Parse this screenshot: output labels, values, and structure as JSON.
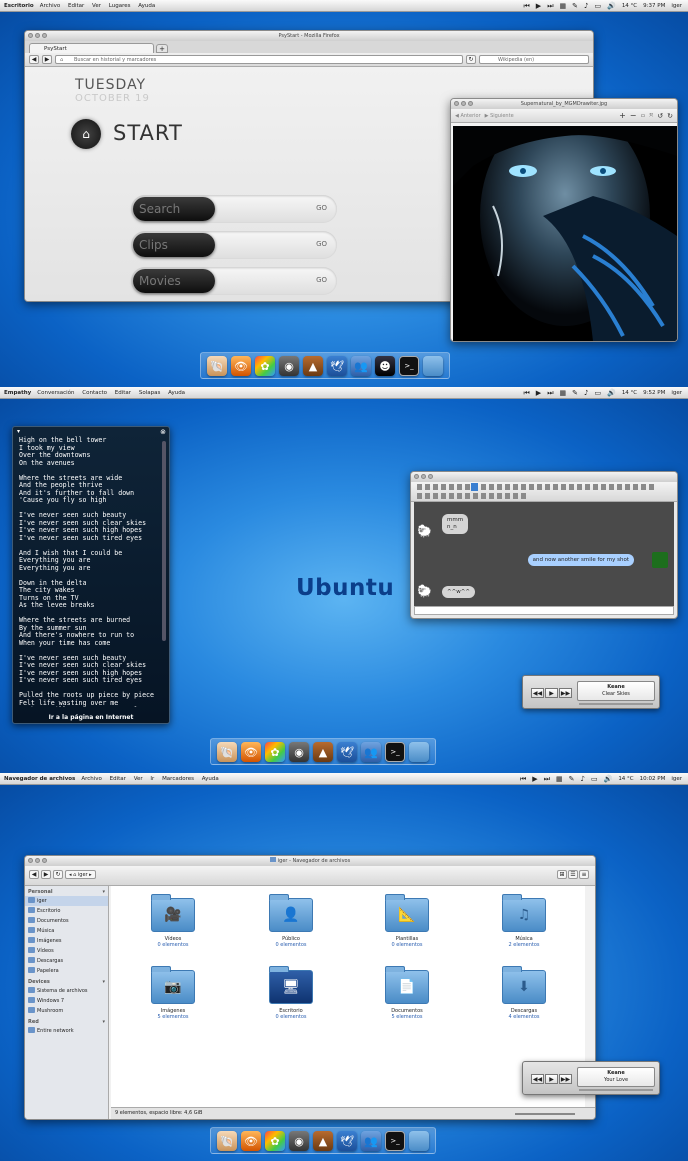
{
  "screen1": {
    "panel": {
      "app": "Escritorio",
      "menus": [
        "Archivo",
        "Editar",
        "Ver",
        "Lugares",
        "Ayuda"
      ],
      "temp": "14 °C",
      "time": "9:37 PM",
      "user": "iger"
    },
    "firefox": {
      "title": "PsyStart - Mozilla Firefox",
      "tab": "PsyStart",
      "url_placeholder": "Buscar en historial y marcadores",
      "search_placeholder": "Wikipedia (en)",
      "day": "TUESDAY",
      "date": "OCTOBER 19",
      "start": "START",
      "rows": [
        {
          "label": "Search",
          "go": "GO"
        },
        {
          "label": "Clips",
          "go": "GO"
        },
        {
          "label": "Movies",
          "go": "GO"
        }
      ]
    },
    "viewer": {
      "title": "Supernatural_by_MGMDrawiter.jpg",
      "prev": "Anterior",
      "next": "Siguiente"
    }
  },
  "screen2": {
    "panel": {
      "app": "Empathy",
      "menus": [
        "Conversación",
        "Contacto",
        "Editar",
        "Solapas",
        "Ayuda"
      ],
      "temp": "14 °C",
      "time": "9:52 PM",
      "user": "iger"
    },
    "lyrics": {
      "text": "High on the bell tower\nI took my view\nOver the downtowns\nOn the avenues\n\nWhere the streets are wide\nAnd the people thrive\nAnd it's further to fall down\n'Cause you fly so high\n\nI've never seen such beauty\nI've never seen such clear skies\nI've never seen such high hopes\nI've never seen such tired eyes\n\nAnd I wish that I could be\nEverything you are\nEverything you are\n\nDown in the delta\nThe city wakes\nTurns on the TV\nAs the levee breaks\n\nWhere the streets are burned\nBy the summer sun\nAnd there's nowhere to run to\nWhen your time has come\n\nI've never seen such beauty\nI've never seen such clear skies\nI've never seen such high hopes\nI've never seen such tired eyes\n\nPulled the roots up piece by piece\nFelt life wasting over me\nTook my pills and I went to sleep",
      "link": "Ir a la página en Internet"
    },
    "wallpaper_text": "Ubuntu",
    "chat": {
      "msg1": "mmm\nn_n",
      "msg2": "and now another smile for my shot",
      "msg3": "^^w^^"
    },
    "player": {
      "artist": "Keane",
      "track": "Clear Skies"
    }
  },
  "screen3": {
    "panel": {
      "app": "Navegador de archivos",
      "menus": [
        "Archivo",
        "Editar",
        "Ver",
        "Ir",
        "Marcadores",
        "Ayuda"
      ],
      "temp": "14 °C",
      "time": "10:02 PM",
      "user": "iger"
    },
    "nautilus": {
      "title": "iger - Navegador de archivos",
      "location": "iger",
      "sections": [
        {
          "title": "Personal",
          "items": [
            "iger",
            "Escritorio",
            "Documentos",
            "Música",
            "Imágenes",
            "Vídeos",
            "Descargas",
            "Papelera"
          ]
        },
        {
          "title": "Devices",
          "items": [
            "Sistema de archivos",
            "Windows 7",
            "Mushroom"
          ]
        },
        {
          "title": "Red",
          "items": [
            "Entire network"
          ]
        }
      ],
      "files": [
        {
          "name": "Vídeos",
          "count": "0 elementos",
          "glyph": "🎥"
        },
        {
          "name": "Público",
          "count": "0 elementos",
          "glyph": "👤"
        },
        {
          "name": "Plantillas",
          "count": "0 elementos",
          "glyph": "📐"
        },
        {
          "name": "Música",
          "count": "2 elementos",
          "glyph": "♫"
        },
        {
          "name": "Imágenes",
          "count": "5 elementos",
          "glyph": "📷"
        },
        {
          "name": "Escritorio",
          "count": "0 elementos",
          "glyph": "🖥"
        },
        {
          "name": "Documentos",
          "count": "5 elementos",
          "glyph": "📄"
        },
        {
          "name": "Descargas",
          "count": "4 elementos",
          "glyph": "⬇"
        }
      ],
      "status": "9 elementos, espacio libre: 4,6 GiB"
    },
    "player": {
      "artist": "Keane",
      "track": "Your Love"
    }
  },
  "dock_icons": [
    "nautilus-shell-icon",
    "eye-of-gnome-icon",
    "picture-icon",
    "speaker-icon",
    "vlc-icon",
    "openoffice-icon",
    "pidgin-icon",
    "supernatural-icon",
    "terminal-icon",
    "folder-icon"
  ],
  "terminal_glyph": ">_"
}
